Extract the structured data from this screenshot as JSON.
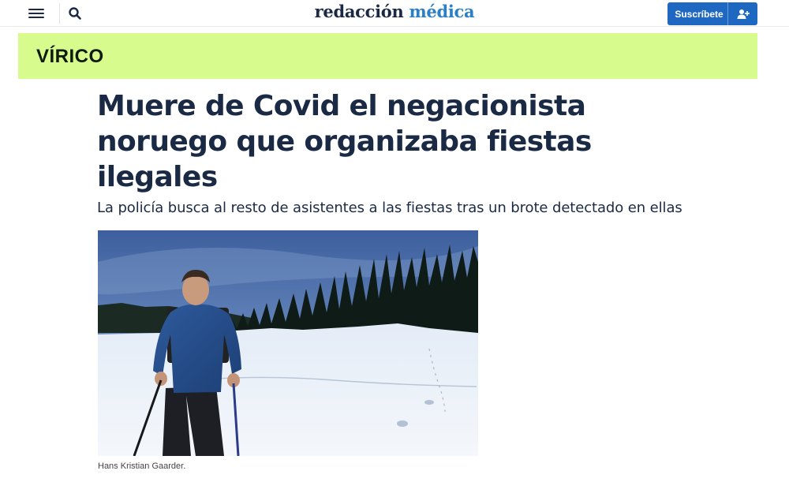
{
  "header": {
    "logo_part1": "redacción",
    "logo_part2": "médica",
    "subscribe_label": "Suscríbete",
    "menu_icon": "hamburger-menu-icon",
    "search_icon": "search-icon",
    "subscribe_icon": "user-plus-icon"
  },
  "section": {
    "name": "VÍRICO",
    "background": "#d8fb8e"
  },
  "article": {
    "headline": "Muere de Covid el negacionista noruego que organizaba fiestas ilegales",
    "subheadline": "La policía busca al resto de asistentes a las fiestas tras un brote detectado en ellas",
    "photo_caption": "Hans Kristian Gaarder."
  },
  "colors": {
    "text_dark": "#1b2a44",
    "brand_blue": "#2a7fc9",
    "button_blue": "#1f68c1"
  }
}
